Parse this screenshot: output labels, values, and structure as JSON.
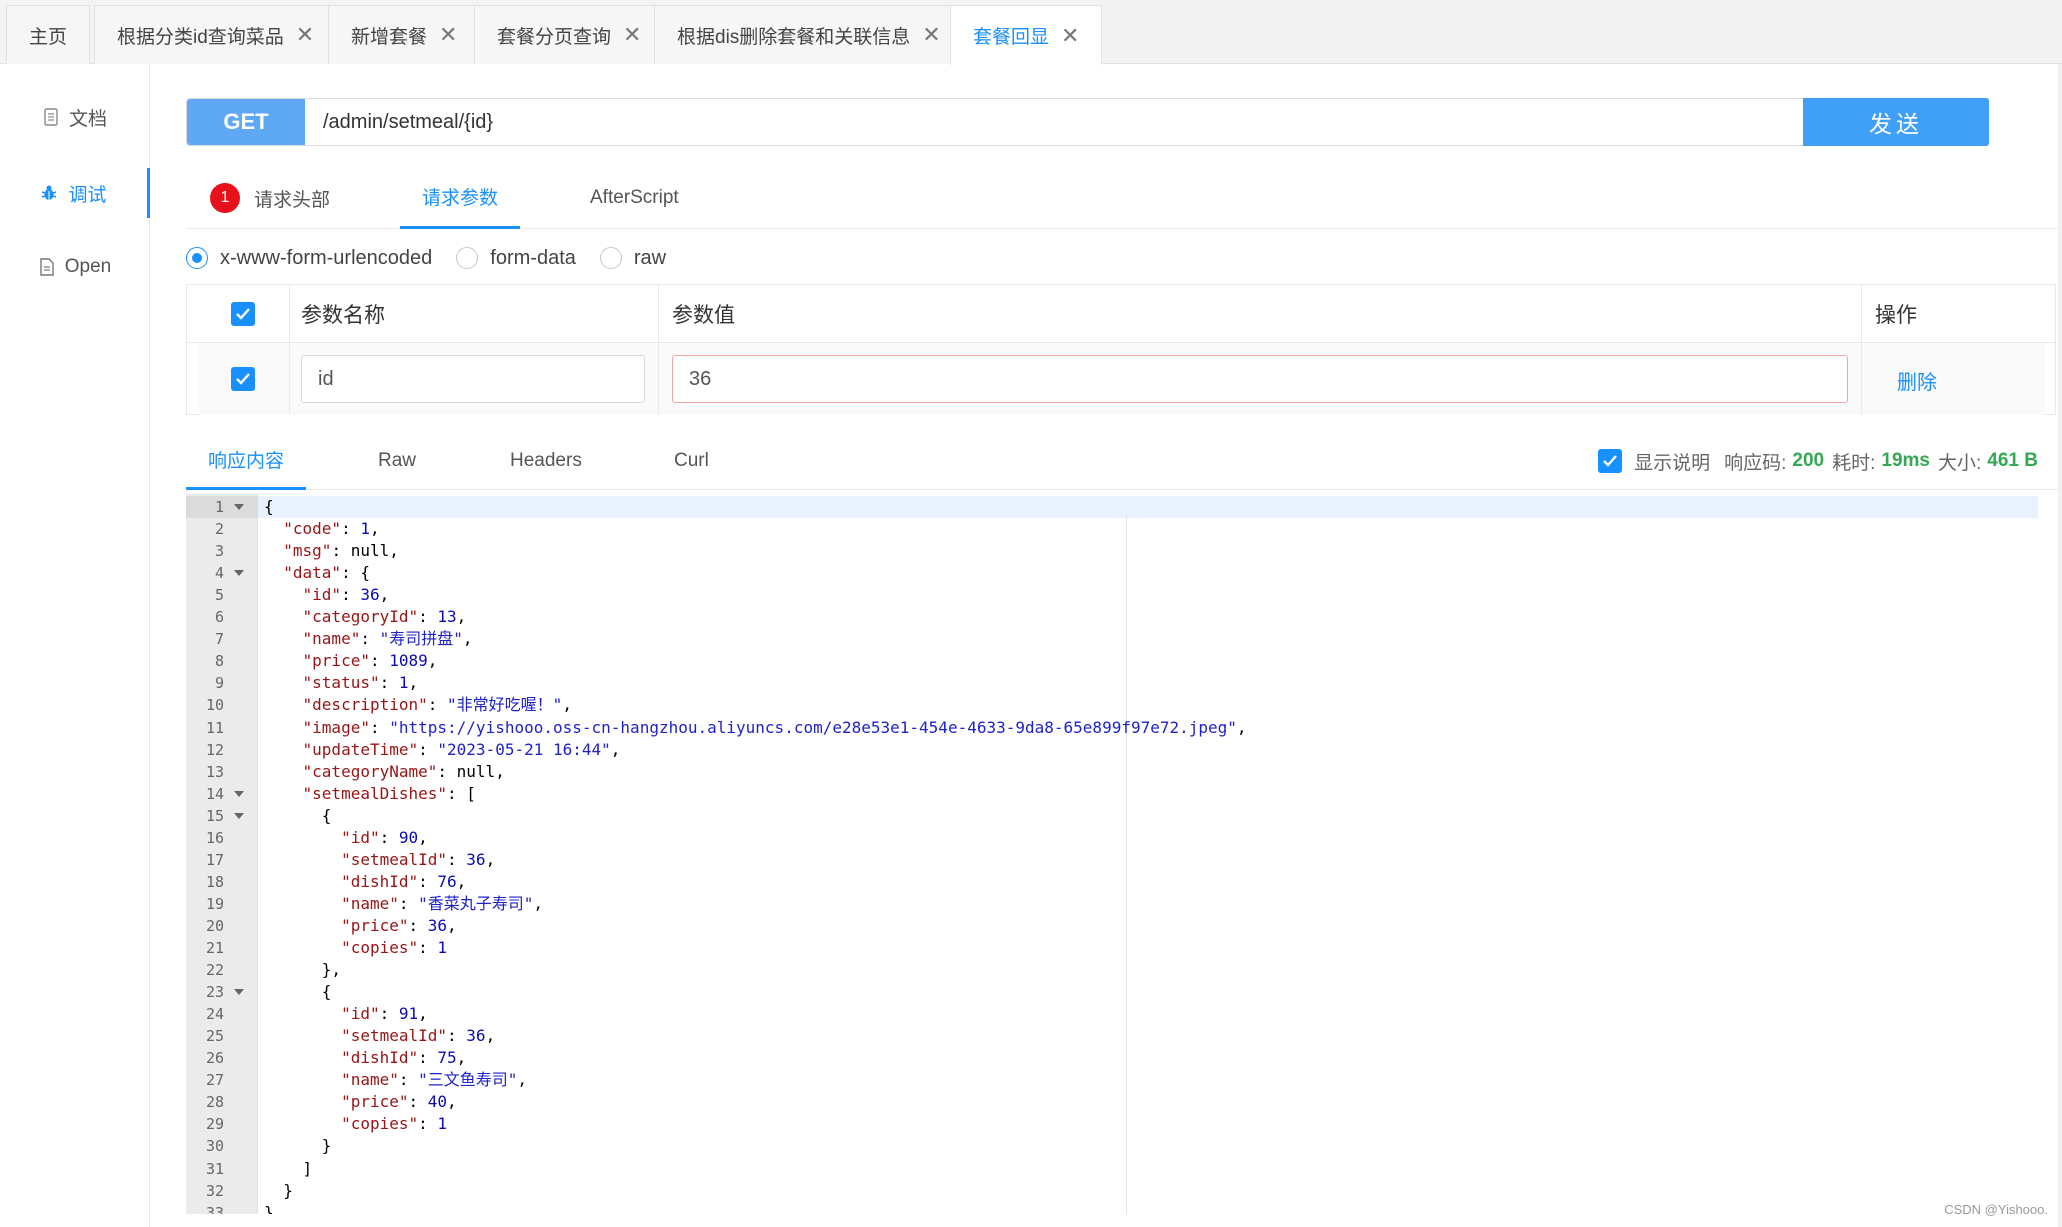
{
  "tabs": [
    {
      "label": "主页",
      "closable": false,
      "active": false
    },
    {
      "label": "根据分类id查询菜品",
      "closable": true,
      "active": false
    },
    {
      "label": "新增套餐",
      "closable": true,
      "active": false
    },
    {
      "label": "套餐分页查询",
      "closable": true,
      "active": false
    },
    {
      "label": "根据dis删除套餐和关联信息",
      "closable": true,
      "active": false
    },
    {
      "label": "套餐回显",
      "closable": true,
      "active": true
    }
  ],
  "close_glyph": "✕",
  "sidebar": {
    "items": [
      {
        "label": "文档",
        "icon": "document-icon"
      },
      {
        "label": "调试",
        "icon": "bug-icon",
        "active": true
      },
      {
        "label": "Open",
        "icon": "file-icon"
      }
    ]
  },
  "request": {
    "method": "GET",
    "url": "/admin/setmeal/{id}",
    "send_label": "发送"
  },
  "request_tabs": {
    "headers_badge": "1",
    "headers_label": "请求头部",
    "params_label": "请求参数",
    "afterscript_label": "AfterScript"
  },
  "body_types": [
    {
      "label": "x-www-form-urlencoded",
      "selected": true
    },
    {
      "label": "form-data",
      "selected": false
    },
    {
      "label": "raw",
      "selected": false
    }
  ],
  "params_table": {
    "headers": {
      "name": "参数名称",
      "value": "参数值",
      "action": "操作"
    },
    "rows": [
      {
        "checked": true,
        "name": "id",
        "value": "36",
        "action": "删除"
      }
    ]
  },
  "response_tabs": [
    {
      "label": "响应内容",
      "active": true
    },
    {
      "label": "Raw"
    },
    {
      "label": "Headers"
    },
    {
      "label": "Curl"
    }
  ],
  "response_status": {
    "show_desc_label": "显示说明",
    "code_label": "响应码:",
    "code": "200",
    "time_label": "耗时:",
    "time": "19ms",
    "size_label": "大小:",
    "size": "461 B"
  },
  "colors": {
    "accent": "#1890ff",
    "method_bg": "#5ea8f4",
    "send_bg": "#40a0f7",
    "status_green": "#34a853",
    "badge_red": "#e8101a",
    "json_key": "#991414",
    "json_string": "#1f22c8",
    "json_number": "#0a0ab8"
  },
  "code_lines": [
    {
      "n": "1",
      "fold": true,
      "text": "{"
    },
    {
      "n": "2",
      "text": "  \"code\": 1,"
    },
    {
      "n": "3",
      "text": "  \"msg\": null,"
    },
    {
      "n": "4",
      "fold": true,
      "text": "  \"data\": {"
    },
    {
      "n": "5",
      "text": "    \"id\": 36,"
    },
    {
      "n": "6",
      "text": "    \"categoryId\": 13,"
    },
    {
      "n": "7",
      "text": "    \"name\": \"寿司拼盘\","
    },
    {
      "n": "8",
      "text": "    \"price\": 1089,"
    },
    {
      "n": "9",
      "text": "    \"status\": 1,"
    },
    {
      "n": "10",
      "text": "    \"description\": \"非常好吃喔！\","
    },
    {
      "n": "11",
      "text": "    \"image\": \"https://yishooo.oss-cn-hangzhou.aliyuncs.com/e28e53e1-454e-4633-9da8-65e899f97e72.jpeg\","
    },
    {
      "n": "12",
      "text": "    \"updateTime\": \"2023-05-21 16:44\","
    },
    {
      "n": "13",
      "text": "    \"categoryName\": null,"
    },
    {
      "n": "14",
      "fold": true,
      "text": "    \"setmealDishes\": ["
    },
    {
      "n": "15",
      "fold": true,
      "text": "      {"
    },
    {
      "n": "16",
      "text": "        \"id\": 90,"
    },
    {
      "n": "17",
      "text": "        \"setmealId\": 36,"
    },
    {
      "n": "18",
      "text": "        \"dishId\": 76,"
    },
    {
      "n": "19",
      "text": "        \"name\": \"香菜丸子寿司\","
    },
    {
      "n": "20",
      "text": "        \"price\": 36,"
    },
    {
      "n": "21",
      "text": "        \"copies\": 1"
    },
    {
      "n": "22",
      "text": "      },"
    },
    {
      "n": "23",
      "fold": true,
      "text": "      {"
    },
    {
      "n": "24",
      "text": "        \"id\": 91,"
    },
    {
      "n": "25",
      "text": "        \"setmealId\": 36,"
    },
    {
      "n": "26",
      "text": "        \"dishId\": 75,"
    },
    {
      "n": "27",
      "text": "        \"name\": \"三文鱼寿司\","
    },
    {
      "n": "28",
      "text": "        \"price\": 40,"
    },
    {
      "n": "29",
      "text": "        \"copies\": 1"
    },
    {
      "n": "30",
      "text": "      }"
    },
    {
      "n": "31",
      "text": "    ]"
    },
    {
      "n": "32",
      "text": "  }"
    },
    {
      "n": "33",
      "text": "}"
    }
  ],
  "watermark": "CSDN @Yishooo."
}
